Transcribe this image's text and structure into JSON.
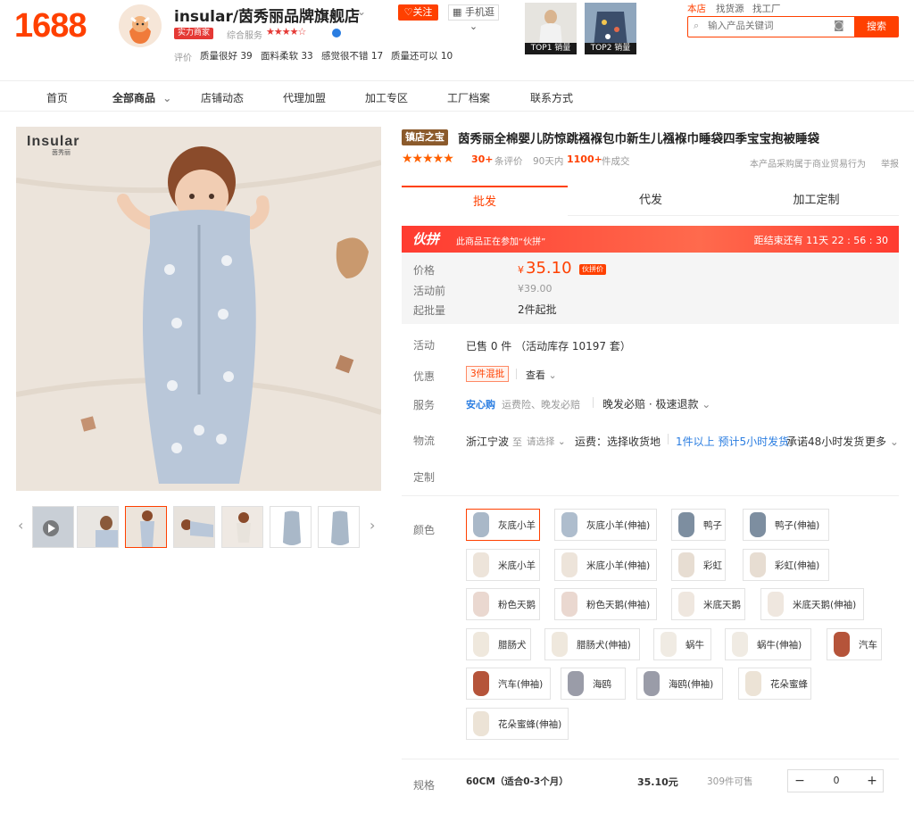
{
  "header": {
    "logo": "1688",
    "shop_name": "insular/茵秀丽品牌旗舰店",
    "follow": "关注",
    "mobile": "手机逛",
    "power_badge": "实力商家",
    "service_label": "综合服务",
    "service_stars": "★★★★☆",
    "review_label": "评价",
    "review_tags": [
      "质量很好 39",
      "面料柔软 33",
      "感觉很不错 17",
      "质量还可以 10"
    ],
    "top_products": [
      "TOP1 销量",
      "TOP2 销量"
    ],
    "scope_tabs": [
      "本店",
      "找货源",
      "找工厂"
    ],
    "search_placeholder": "输入产品关键词",
    "search_button": "搜索",
    "brand_color": "#ff4000"
  },
  "nav": {
    "items": [
      "首页",
      "全部商品",
      "店铺动态",
      "代理加盟",
      "加工专区",
      "工厂档案",
      "联系方式"
    ],
    "chevron": "chevron-down-icon"
  },
  "gallery": {
    "brand_text": "Insular",
    "brand_sub": "茵秀丽"
  },
  "product": {
    "title_badge": "镇店之宝",
    "title": "茵秀丽全棉婴儿防惊跳襁褓包巾新生儿襁褓巾睡袋四季宝宝抱被睡袋",
    "stars": "★★★★★",
    "review_count": "30+",
    "review_suffix": "条评价",
    "days_label": "90天内",
    "deal_count": "1100+",
    "deal_suffix": "件成交",
    "trade_note": "本产品采购属于商业贸易行为",
    "report": "举报",
    "tabs": [
      "批发",
      "代发",
      "加工定制"
    ],
    "promo": {
      "logo": "伙拼",
      "text": "此商品正在参加“伙拼”",
      "countdown": "距结束还有 11天 22 : 56 : 30"
    },
    "price": {
      "label": "价格",
      "currency": "¥",
      "value": "35.10",
      "tag": "伙拼价",
      "orig_label": "活动前",
      "orig": "¥39.00",
      "min_label": "起批量",
      "min": "2件起批"
    },
    "activity": {
      "label": "活动",
      "text": "已售 0 件 （活动库存 10197 套）"
    },
    "discount": {
      "label": "优惠",
      "tag": "3件混批",
      "view": "查看"
    },
    "service": {
      "label": "服务",
      "brand": "安心购",
      "items": "运费险、晚发必赔",
      "guarantee": "晚发必赔 · 极速退款"
    },
    "logistics": {
      "label": "物流",
      "origin": "浙江宁波",
      "to": "至",
      "select": "请选择",
      "freight": "运费：选择收货地",
      "ship": "1件以上 预计5小时发货",
      "promise": "承诺48小时发货",
      "more": "更多"
    },
    "custom": {
      "label": "定制"
    },
    "color_label": "颜色",
    "colors": [
      {
        "label": "灰底小羊",
        "swatch": "#a9b8c8"
      },
      {
        "label": "灰底小羊(伸袖)",
        "swatch": "#aebdcd"
      },
      {
        "label": "鸭子",
        "swatch": "#7d8ea0"
      },
      {
        "label": "鸭子(伸袖)",
        "swatch": "#7d8ea0"
      },
      {
        "label": "米底小羊",
        "swatch": "#ede4da"
      },
      {
        "label": "米底小羊(伸袖)",
        "swatch": "#ede4da"
      },
      {
        "label": "彩虹",
        "swatch": "#e7ddd2"
      },
      {
        "label": "彩虹(伸袖)",
        "swatch": "#e7ddd2"
      },
      {
        "label": "粉色天鹅",
        "swatch": "#ead8d0"
      },
      {
        "label": "粉色天鹅(伸袖)",
        "swatch": "#ead8d0"
      },
      {
        "label": "米底天鹅",
        "swatch": "#efe7df"
      },
      {
        "label": "米底天鹅(伸袖)",
        "swatch": "#efe7df"
      },
      {
        "label": "腊肠犬",
        "swatch": "#efe8dd"
      },
      {
        "label": "腊肠犬(伸袖)",
        "swatch": "#efe8dd"
      },
      {
        "label": "蜗牛",
        "swatch": "#f0ebe3"
      },
      {
        "label": "蜗牛(伸袖)",
        "swatch": "#f0ebe3"
      },
      {
        "label": "汽车",
        "swatch": "#b5543a"
      },
      {
        "label": "汽车(伸袖)",
        "swatch": "#b5543a"
      },
      {
        "label": "海鸥",
        "swatch": "#9a9ca8"
      },
      {
        "label": "海鸥(伸袖)",
        "swatch": "#9a9ca8"
      },
      {
        "label": "花朵蜜蜂",
        "swatch": "#ece3d6"
      },
      {
        "label": "花朵蜜蜂(伸袖)",
        "swatch": "#ece3d6"
      }
    ],
    "spec": {
      "label": "规格",
      "name": "60CM（适合0-3个月）",
      "price": "35.10元",
      "stock": "309件可售",
      "minus": "−",
      "qty": "0",
      "plus": "+"
    }
  }
}
